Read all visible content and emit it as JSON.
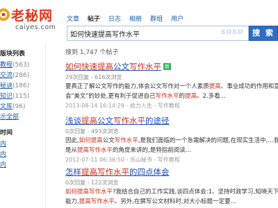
{
  "logo": {
    "name": "老秘网",
    "domain": "caiyes.com"
  },
  "tabs": [
    {
      "label": "文章",
      "active": false
    },
    {
      "label": "帖子",
      "active": true
    },
    {
      "label": "日志",
      "active": false
    },
    {
      "label": "相册",
      "active": false
    },
    {
      "label": "群组",
      "active": false
    },
    {
      "label": "用户",
      "active": false
    }
  ],
  "search": {
    "query": "如何快速提高写作水平",
    "watermark": "SOSO",
    "button": "搜 索"
  },
  "sidebar": {
    "board_title": "版块列表",
    "boards": [
      {
        "label": "教程",
        "count": "(563)"
      },
      {
        "label": "交流",
        "count": "(286)"
      },
      {
        "label": "秘诀",
        "count": "(186)"
      },
      {
        "label": "知识",
        "count": "(115)"
      },
      {
        "label": "文库",
        "count": "(96)"
      }
    ],
    "show_all": "示全部",
    "time_title": "时间",
    "time_items": [
      "内",
      "内",
      "内"
    ]
  },
  "result_count": "搜到 1,747 个帖子",
  "results": [
    {
      "title": [
        "如何",
        "快速",
        "提高",
        "公文",
        "写作水平"
      ],
      "title_hl": [
        true,
        true,
        true,
        false,
        true
      ],
      "badge": "新",
      "meta": "29次回复 - 616次浏览",
      "snippet1": [
        {
          "t": "要真正了解公文写作的能力,体会公文写作对一个人素质",
          "h": false
        },
        {
          "t": "提高",
          "h": true
        },
        {
          "t": "、事业成功的作用和意义…这体",
          "h": false
        }
      ],
      "snippet2": [
        {
          "t": "会\"美文\"的妙处,更有利于促进自己",
          "h": false
        },
        {
          "t": "写作水平",
          "h": true
        },
        {
          "t": "的",
          "h": false
        },
        {
          "t": "提高",
          "h": true
        },
        {
          "t": "。2.多看...",
          "h": false
        }
      ],
      "footer": "2013-08-14 16:14:29 - 给力人生 - 写作教程"
    },
    {
      "title": [
        "浅谈",
        "提高",
        "公文",
        "写作水平",
        "的途径"
      ],
      "title_hl": [
        false,
        true,
        false,
        true,
        false
      ],
      "badge": "",
      "meta": "0次回复 - 493次浏览",
      "snippet1": [
        {
          "t": "因此,",
          "h": false
        },
        {
          "t": "如何提高",
          "h": true
        },
        {
          "t": "公文",
          "h": false
        },
        {
          "t": "写作水平",
          "h": true
        },
        {
          "t": ",是我们面临的一个急需解决的问题,在现实生活中,…我们这里",
          "h": false
        }
      ],
      "snippet2": [
        {
          "t": "是从",
          "h": false
        },
        {
          "t": "提高写作水平",
          "h": true
        },
        {
          "t": "的角度来讲的,是特指前阅读…",
          "h": false
        }
      ],
      "footer": "2012-07-11 06:36:50 - 乐山秘书 - 写作教程"
    },
    {
      "title": [
        "怎样",
        "提高",
        "写作水平",
        "的四点体会"
      ],
      "title_hl": [
        false,
        true,
        true,
        false
      ],
      "badge": "",
      "meta": "0次回复 - 122次浏览",
      "snippet1": [
        {
          "t": "如何提高写作水平",
          "h": true
        },
        {
          "t": "?我结合自己的工作实践,谈四点体会:1、坚持时政学习,知晓天下…就能不",
          "h": false
        }
      ],
      "snippet2": [
        {
          "t": "能力,",
          "h": false
        },
        {
          "t": "提高写作水平",
          "h": true
        },
        {
          "t": "。另外,在撰写公文材料时,对大小标题一定要…",
          "h": false
        }
      ],
      "footer": ""
    }
  ],
  "colors": {
    "link": "#1a4cbb",
    "highlight": "#d0301a",
    "button": "#2f6cc4",
    "logo": "#d93a1f"
  }
}
